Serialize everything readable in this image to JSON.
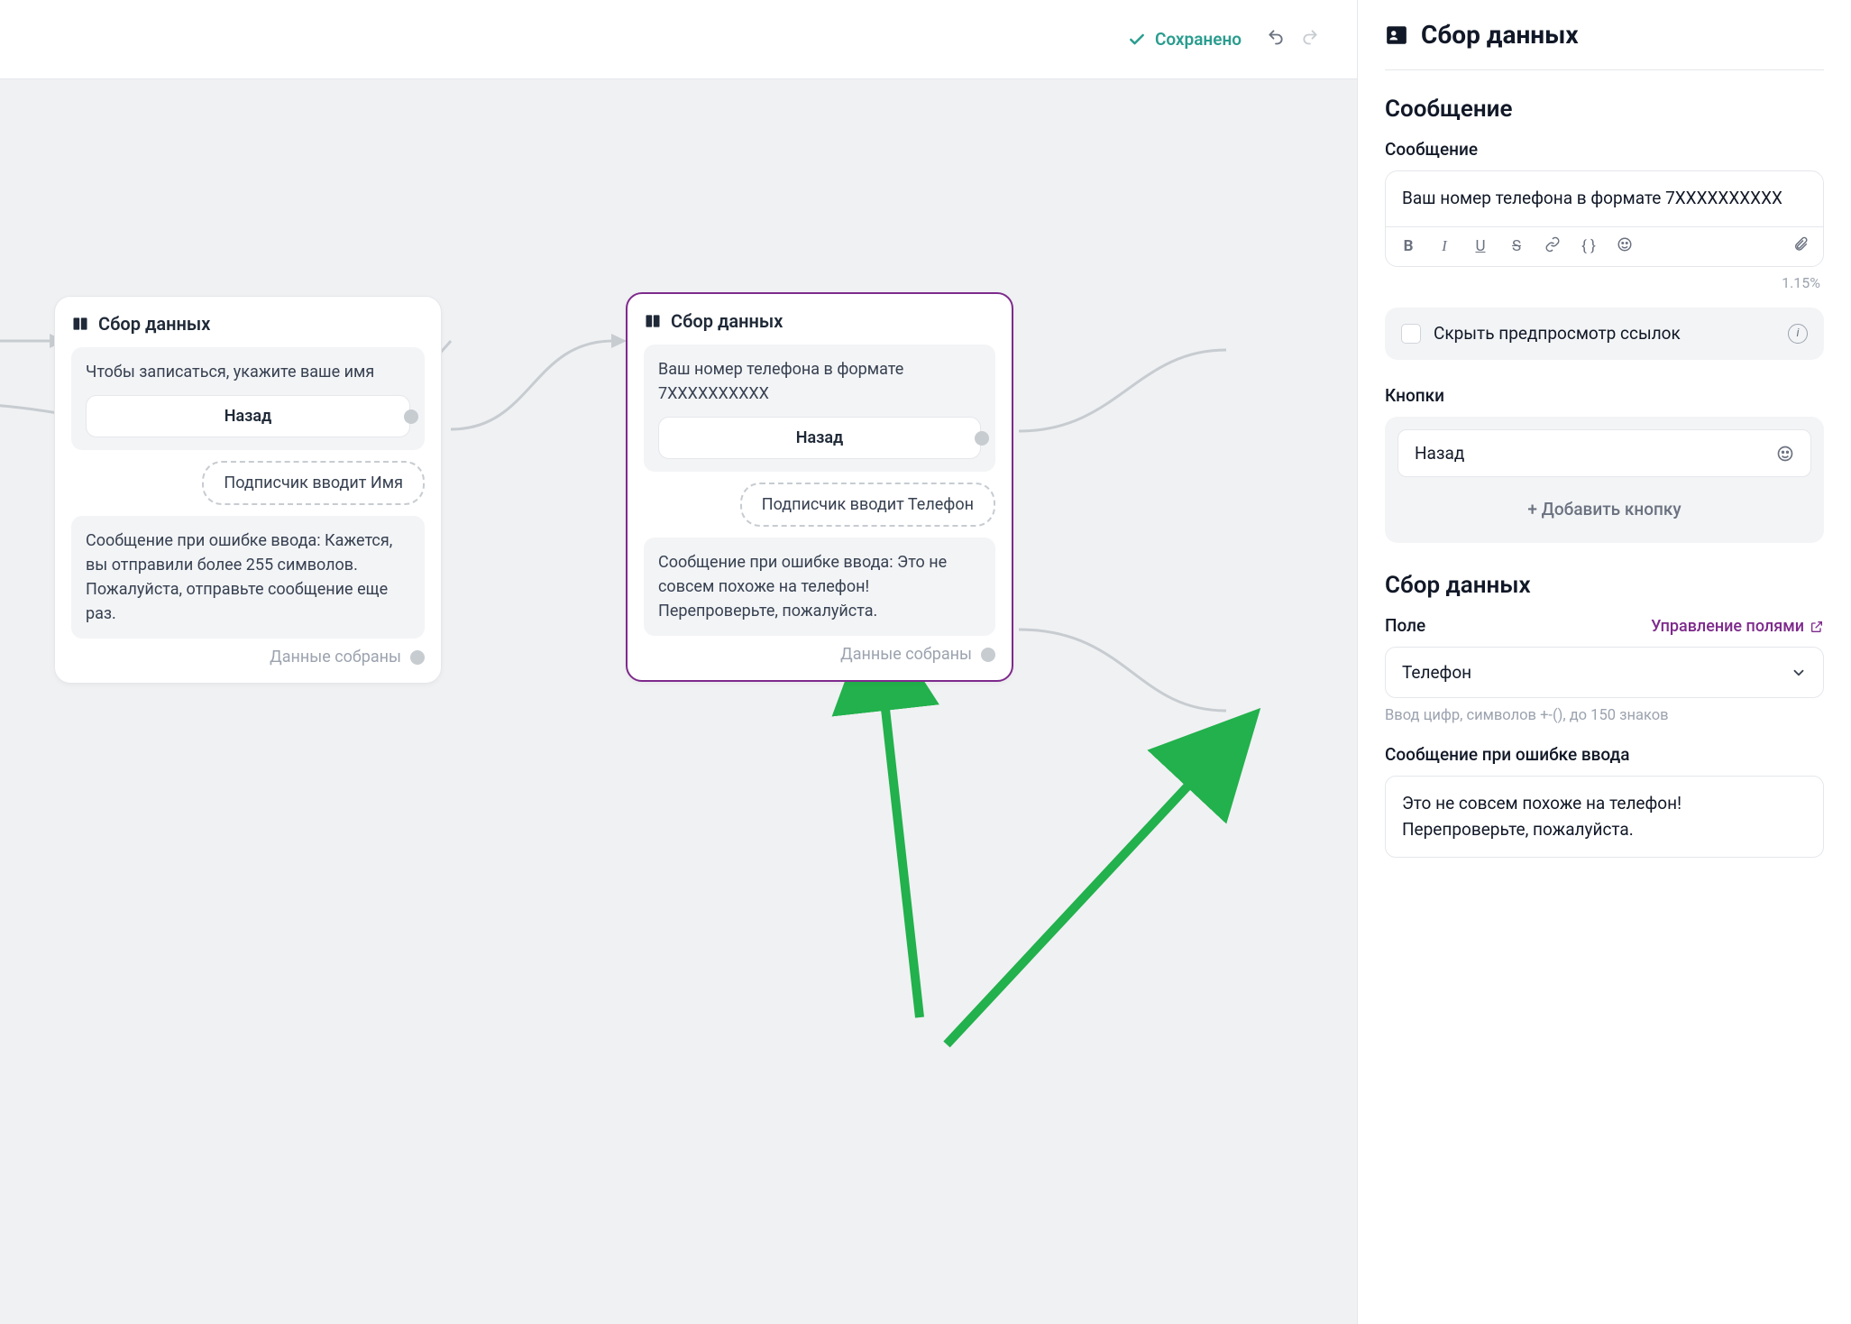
{
  "topbar": {
    "saved_label": "Сохранено"
  },
  "canvas": {
    "card_left": {
      "title": "Сбор данных",
      "message": "Чтобы записаться, укажите ваше имя",
      "button_label": "Назад",
      "input_chip": "Подписчик вводит Имя",
      "error_text": "Сообщение при ошибке ввода: Кажется, вы отправили более 255 символов. Пожалуйста, отправьте сообщение еще раз.",
      "footer_label": "Данные собраны"
    },
    "card_right": {
      "title": "Сбор данных",
      "message": "Ваш номер телефона в формате 7XXXXXXXXXX",
      "button_label": "Назад",
      "input_chip": "Подписчик вводит Телефон",
      "error_text": "Сообщение при ошибке ввода: Это не совсем похоже на телефон! Перепроверьте, пожалуйста.",
      "footer_label": "Данные собраны"
    }
  },
  "sidepanel": {
    "header": "Сбор данных",
    "section_message_title": "Сообщение",
    "message_label": "Сообщение",
    "message_value": "Ваш номер телефона в формате 7XXXXXXXXXX",
    "percent": "1.15%",
    "hide_preview_label": "Скрыть предпросмотр ссылок",
    "buttons_label": "Кнопки",
    "btn_back_label": "Назад",
    "add_button_label": "+   Добавить кнопку",
    "section_collect_title": "Сбор данных",
    "field_label": "Поле",
    "manage_fields_label": "Управление полями",
    "field_value": "Телефон",
    "field_hint": "Ввод цифр, символов +-(), до 150 знаков",
    "error_label": "Сообщение при ошибке ввода",
    "error_value": "Это не совсем похоже на телефон! Перепроверьте, пожалуйста."
  },
  "icons": {
    "collect": "collect-icon",
    "check": "check-icon",
    "undo": "undo-icon",
    "redo": "redo-icon"
  }
}
